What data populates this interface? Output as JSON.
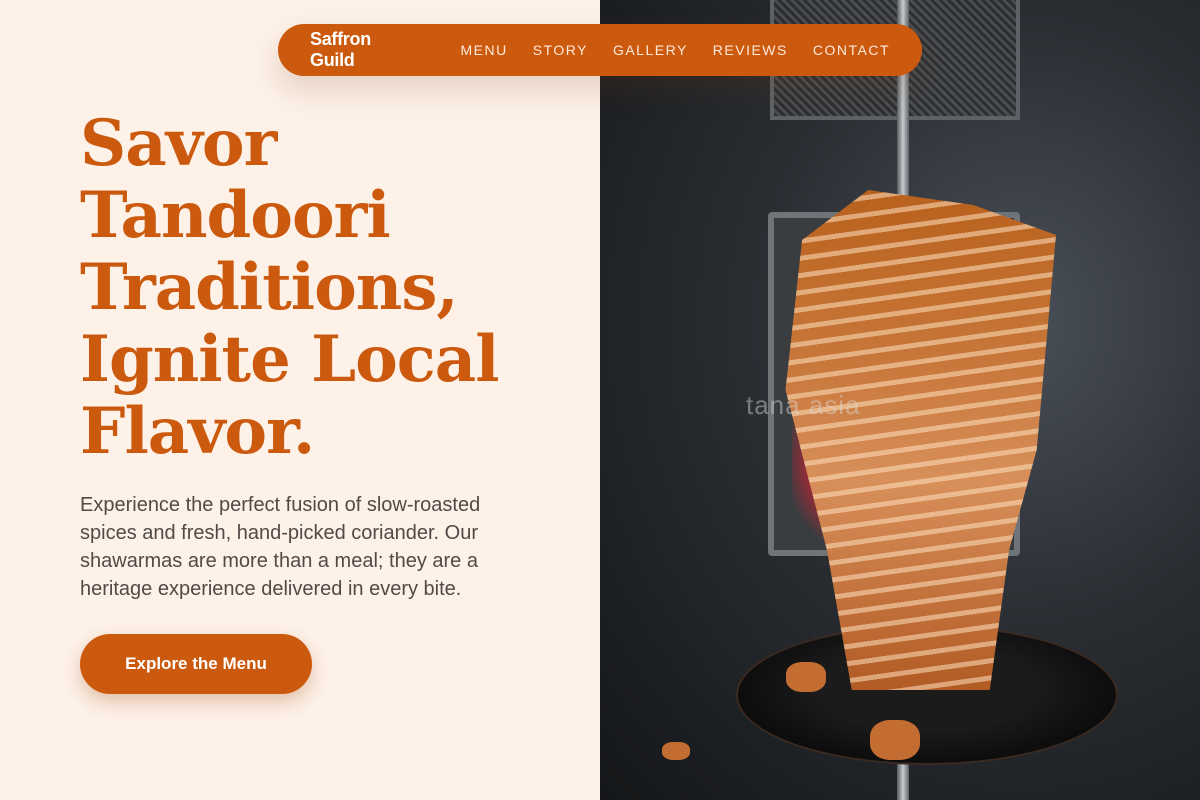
{
  "nav": {
    "brand": "Saffron Guild",
    "links": [
      "MENU",
      "STORY",
      "GALLERY",
      "REVIEWS",
      "CONTACT"
    ]
  },
  "hero": {
    "headline": [
      "Savor",
      "Tandoori",
      "Traditions,",
      "Ignite Local",
      "Flavor."
    ],
    "lead": "Experience the perfect fusion of slow-roasted spices and fresh, hand-picked coriander. Our shawarmas are more than a meal; they are a heritage experience delivered in every bite.",
    "cta_label": "Explore the Menu"
  },
  "image": {
    "watermark": "tana          asia"
  },
  "colors": {
    "accent": "#cc5a0e",
    "background": "#fdf1e8",
    "body_text": "#514a46"
  }
}
